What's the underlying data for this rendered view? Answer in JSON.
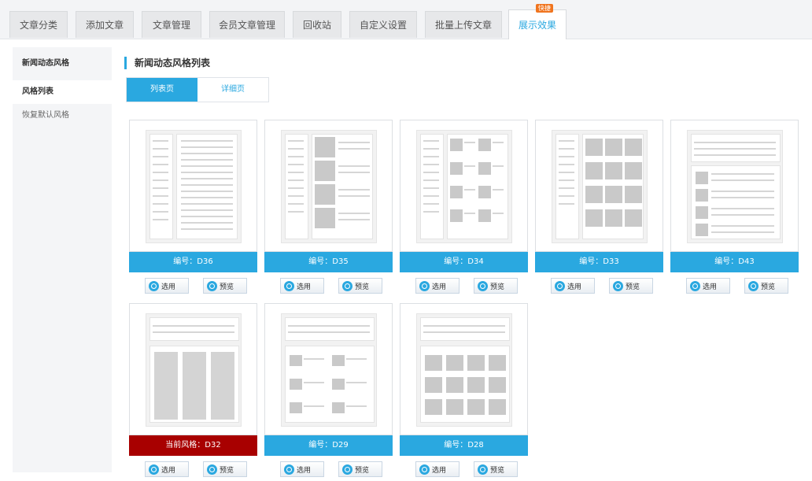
{
  "tabs": [
    {
      "label": "文章分类"
    },
    {
      "label": "添加文章"
    },
    {
      "label": "文章管理"
    },
    {
      "label": "会员文章管理"
    },
    {
      "label": "回收站"
    },
    {
      "label": "自定义设置"
    },
    {
      "label": "批量上传文章"
    },
    {
      "label": "展示效果",
      "badge": "快捷",
      "active": true
    }
  ],
  "sidebar": {
    "title": "新闻动态风格",
    "items": [
      {
        "label": "风格列表",
        "active": true
      },
      {
        "label": "恢复默认风格"
      }
    ]
  },
  "main": {
    "title": "新闻动态风格列表",
    "subtabs": [
      {
        "label": "列表页",
        "active": true
      },
      {
        "label": "详细页"
      }
    ],
    "select_label": "选用",
    "preview_label": "预览",
    "accent_color": "#2aa8e0",
    "current_color": "#a80000",
    "styles": [
      {
        "code": "编号：D36",
        "layout": "list"
      },
      {
        "code": "编号：D35",
        "layout": "list-image"
      },
      {
        "code": "编号：D34",
        "layout": "grid-image-text"
      },
      {
        "code": "编号：D33",
        "layout": "grid"
      },
      {
        "code": "编号：D43",
        "layout": "top-list"
      },
      {
        "code": "当前风格：D32",
        "layout": "columns",
        "current": true
      },
      {
        "code": "编号：D29",
        "layout": "top-grid-text"
      },
      {
        "code": "编号：D28",
        "layout": "top-grid"
      }
    ]
  }
}
